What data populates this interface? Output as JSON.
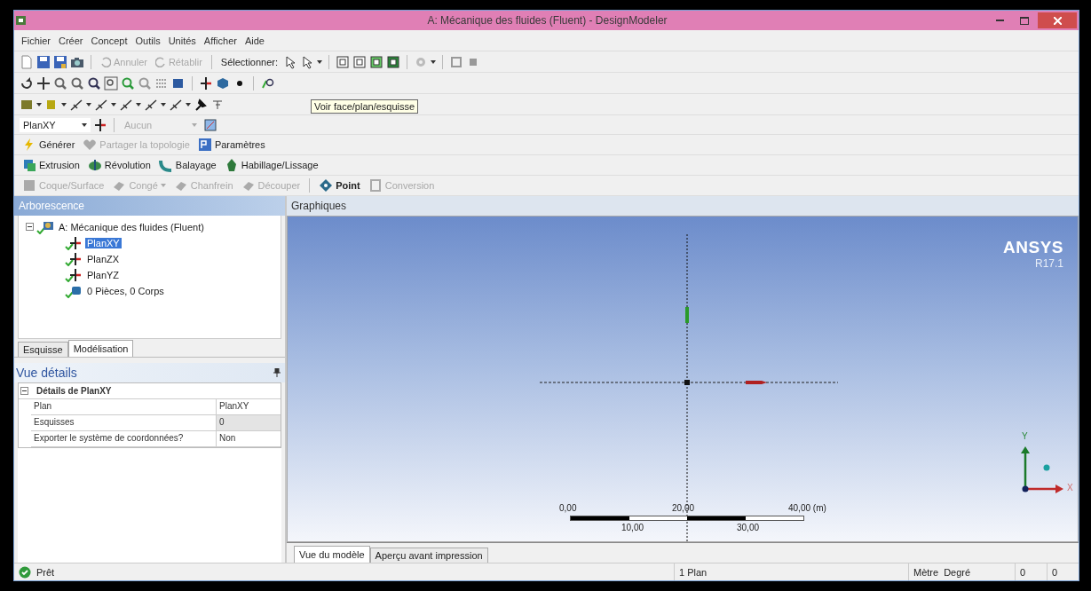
{
  "window": {
    "title": "A: Mécanique des fluides (Fluent) - DesignModeler"
  },
  "menu": [
    "Fichier",
    "Créer",
    "Concept",
    "Outils",
    "Unités",
    "Afficher",
    "Aide"
  ],
  "toolbar": {
    "undo": {
      "label": "Annuler",
      "disabled": true
    },
    "redo": {
      "label": "Rétablir",
      "disabled": true
    },
    "select_label": "Sélectionner:"
  },
  "plane_bar": {
    "plane": "PlanXY",
    "sketch": {
      "value": "Aucun",
      "disabled": true
    }
  },
  "tooltip": "Voir face/plan/esquisse",
  "action_bars": [
    [
      {
        "kind": "generate",
        "label": "Générer",
        "disabled": false,
        "dropdown": false
      },
      {
        "kind": "share",
        "label": "Partager la topologie",
        "disabled": true,
        "dropdown": false
      },
      {
        "kind": "params",
        "label": "Paramètres",
        "disabled": false,
        "dropdown": false
      }
    ],
    [
      {
        "kind": "extrude",
        "label": "Extrusion",
        "disabled": false,
        "dropdown": false
      },
      {
        "kind": "revolve",
        "label": "Révolution",
        "disabled": false,
        "dropdown": false
      },
      {
        "kind": "sweep",
        "label": "Balayage",
        "disabled": false,
        "dropdown": false
      },
      {
        "kind": "skin",
        "label": "Habillage/Lissage",
        "disabled": false,
        "dropdown": false
      }
    ],
    [
      {
        "kind": "shell",
        "label": "Coque/Surface",
        "disabled": true,
        "dropdown": false
      },
      {
        "kind": "blend",
        "label": "Congé",
        "disabled": true,
        "dropdown": true
      },
      {
        "kind": "chamfer",
        "label": "Chanfrein",
        "disabled": true,
        "dropdown": false
      },
      {
        "kind": "slice",
        "label": "Découper",
        "disabled": true,
        "dropdown": false
      },
      {
        "kind": "point",
        "label": "Point",
        "disabled": false,
        "dropdown": false
      },
      {
        "kind": "conversion",
        "label": "Conversion",
        "disabled": true,
        "dropdown": false
      }
    ]
  ],
  "tree_panel": {
    "title": "Arborescence",
    "tree": [
      {
        "label": "A: Mécanique des fluides (Fluent)",
        "kind": "model",
        "selected": false,
        "expanded": true,
        "children": [
          {
            "label": "PlanXY",
            "kind": "plane",
            "selected": true
          },
          {
            "label": "PlanZX",
            "kind": "plane",
            "selected": false
          },
          {
            "label": "PlanYZ",
            "kind": "plane",
            "selected": false
          },
          {
            "label": "0 Pièces, 0 Corps",
            "kind": "bodies",
            "selected": false
          }
        ]
      }
    ]
  },
  "left_tabs": [
    {
      "label": "Esquisse",
      "selected": false
    },
    {
      "label": "Modélisation",
      "selected": true
    }
  ],
  "details": {
    "title": "Vue détails",
    "group": {
      "label": "Détails de PlanXY",
      "expanded": true
    },
    "rows": [
      {
        "name": "Plan",
        "value": "PlanXY",
        "readonly": false
      },
      {
        "name": "Esquisses",
        "value": "0",
        "readonly": true
      },
      {
        "name": "Exporter le système de coordonnées?",
        "value": "Non",
        "readonly": false
      }
    ]
  },
  "graphics": {
    "title": "Graphiques",
    "logo": {
      "brand": "ANSYS",
      "version": "R17.1"
    },
    "scale": {
      "top_labels": [
        "0,00",
        "20,00",
        "40,00 (m)"
      ],
      "bottom_labels": [
        "10,00",
        "30,00"
      ]
    },
    "triad": {
      "y_label": "Y",
      "x_label": "X"
    }
  },
  "view_tabs": [
    {
      "label": "Vue du modèle",
      "selected": true
    },
    {
      "label": "Aperçu avant impression",
      "selected": false
    }
  ],
  "status_bar": {
    "message": "Prêt",
    "selection": "1 Plan",
    "length_unit": "Mètre",
    "angle_unit": "Degré",
    "fields": [
      "0",
      "0"
    ]
  }
}
